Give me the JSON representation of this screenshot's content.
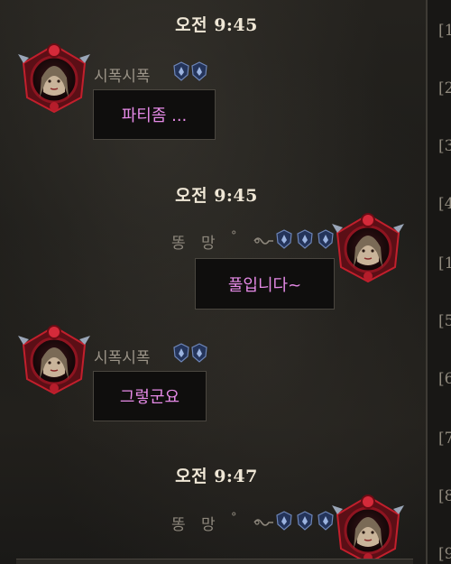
{
  "chat": {
    "timestamps": [
      "오전 9:45",
      "오전 9:45",
      "오전 9:47"
    ],
    "messages": [
      {
        "sender": "시폭시폭",
        "text": "파티좀 ..."
      },
      {
        "sender": "똥 망",
        "text": "풀입니다~"
      },
      {
        "sender": "시폭시폭",
        "text": "그렇군요"
      },
      {
        "sender": "똥 망",
        "text": ""
      }
    ]
  },
  "sidebar": {
    "markers": [
      "[1",
      "[2",
      "[3",
      "[4",
      "[1",
      "[5",
      "[6",
      "[7",
      "[8",
      "[9"
    ]
  },
  "colors": {
    "message_text": "#e58ae6",
    "timestamp": "#efe7d6",
    "name": "#9b9488",
    "bubble_bg": "#0f0e0d",
    "bubble_border": "#4a463f"
  },
  "icons": {
    "avatar": "character-portrait-icon",
    "rank_badge": "blue-rank-shield-icon",
    "name_decoration": "degree-glyph",
    "tail_decoration": "swirl-icon"
  }
}
